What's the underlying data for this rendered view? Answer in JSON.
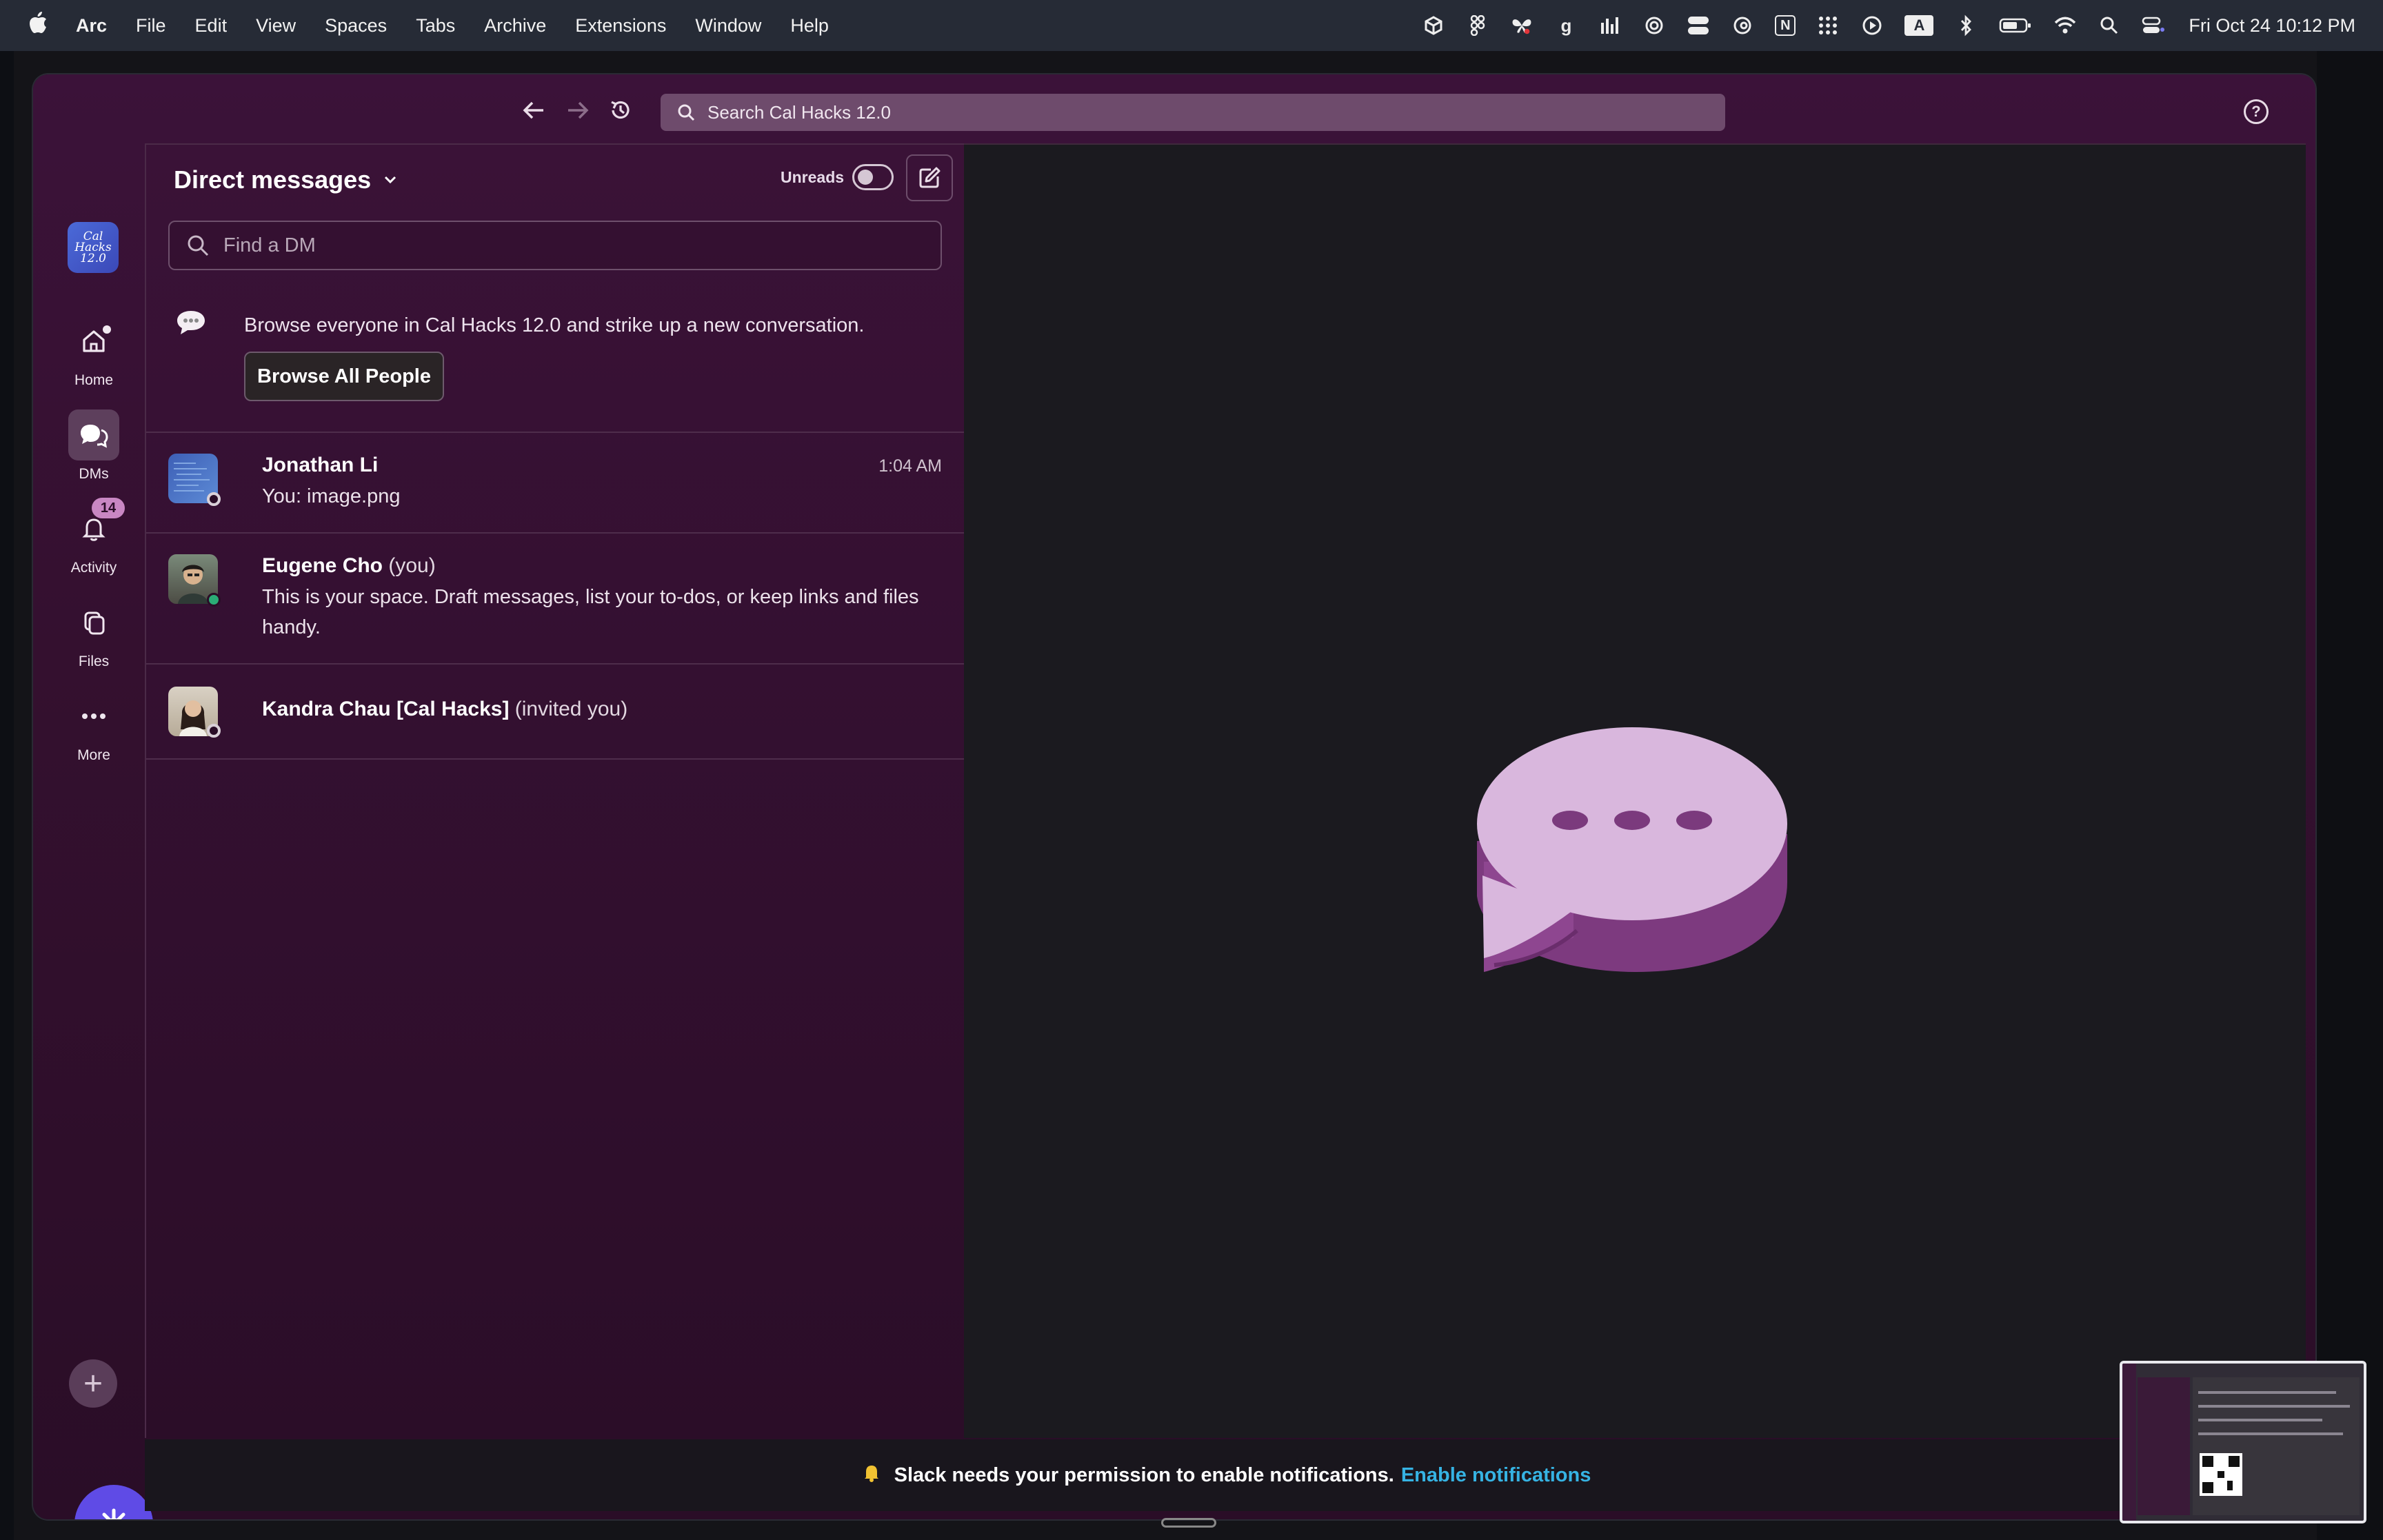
{
  "menubar": {
    "app_name": "Arc",
    "menus": [
      "File",
      "Edit",
      "View",
      "Spaces",
      "Tabs",
      "Archive",
      "Extensions",
      "Window",
      "Help"
    ],
    "tray_letters": {
      "g_icon": "g",
      "notion_icon": "N",
      "input_icon": "A"
    },
    "clock": "Fri Oct 24  10:12 PM"
  },
  "toolbar": {
    "search_placeholder": "Search Cal Hacks 12.0",
    "help_glyph": "?"
  },
  "workspace": {
    "logo_text": "Cal Hacks 12.0"
  },
  "rail": {
    "items": [
      {
        "label": "Home",
        "icon": "home-icon"
      },
      {
        "label": "DMs",
        "icon": "dm-icon"
      },
      {
        "label": "Activity",
        "icon": "bell-icon",
        "badge": "14"
      },
      {
        "label": "Files",
        "icon": "files-icon"
      },
      {
        "label": "More",
        "icon": "more-icon"
      }
    ],
    "add_glyph": "+"
  },
  "dm_panel": {
    "title": "Direct messages",
    "unreads_label": "Unreads",
    "find_placeholder": "Find a DM",
    "browse_text": "Browse everyone in Cal Hacks 12.0 and strike up a new conversation.",
    "browse_button": "Browse All People",
    "conversations": [
      {
        "name": "Jonathan Li",
        "suffix": "",
        "preview": "You: image.png",
        "time": "1:04 AM",
        "status": "away"
      },
      {
        "name": "Eugene Cho",
        "suffix": "(you)",
        "preview": "This is your space. Draft messages, list your to-dos, or keep links and files handy.",
        "time": "",
        "status": "active"
      },
      {
        "name": "Kandra Chau [Cal Hacks]",
        "suffix": "(invited you)",
        "preview": "",
        "time": "",
        "status": "away"
      }
    ]
  },
  "notification_bar": {
    "text": "Slack needs your permission to enable notifications.",
    "link": "Enable notifications"
  },
  "colors": {
    "sidebar": "#3b1239",
    "main_bg": "#1b1a1f",
    "accent_link": "#36b3e3",
    "bubble_light": "#dcb9e0",
    "bubble_dark": "#8a3f8c"
  }
}
